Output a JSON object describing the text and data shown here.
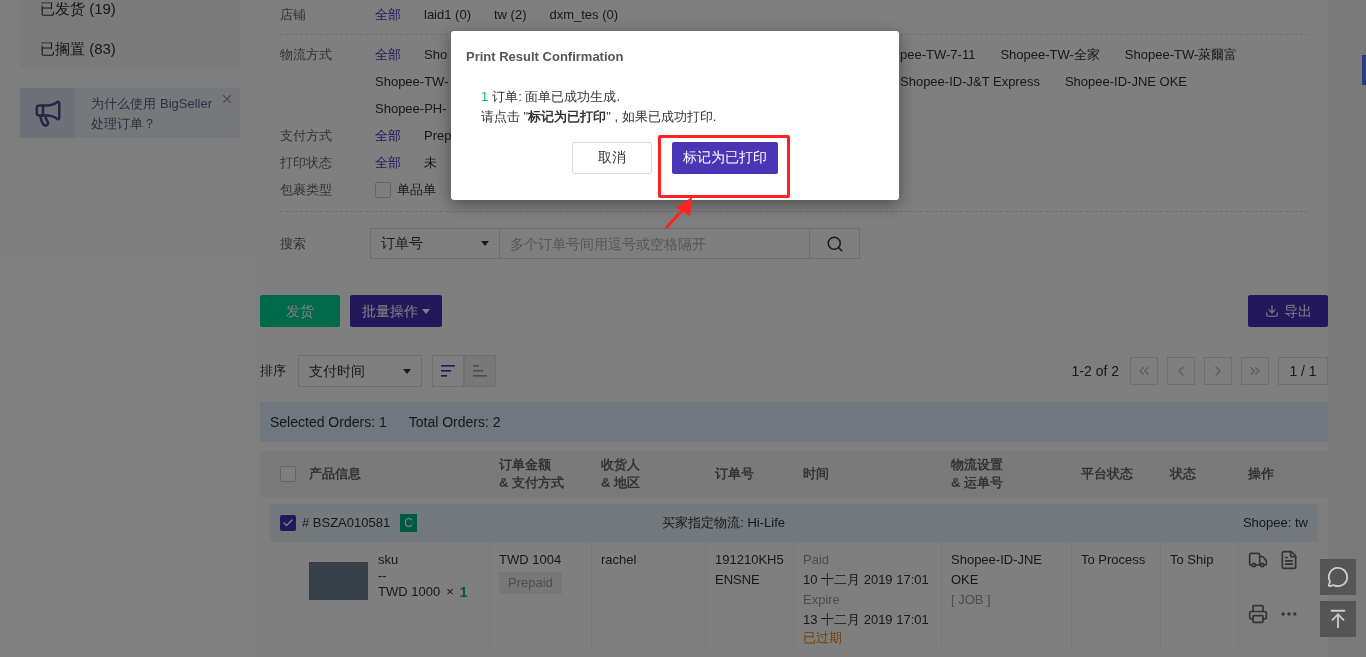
{
  "sidebar": {
    "status_items": [
      {
        "label": "已发货 (19)"
      },
      {
        "label": "已搁置 (83)"
      }
    ],
    "promo": {
      "text": "为什么使用 BigSeller处理订单？"
    }
  },
  "filters": [
    {
      "label": "店铺",
      "kind": "options",
      "lines": [
        {
          "left": [
            {
              "label": "全部",
              "selected": true
            },
            {
              "label": "laid1 (0)",
              "selected": false
            },
            {
              "label": "tw (2)",
              "selected": false
            },
            {
              "label": "dxm_tes (0)",
              "selected": false
            }
          ]
        }
      ]
    },
    {
      "label": "物流方式",
      "kind": "options",
      "lines": [
        {
          "left": [
            {
              "label": "全部",
              "selected": true
            },
            {
              "label": "Sho",
              "selected": false
            }
          ],
          "right": [
            {
              "label": "pee-TW-7-11",
              "selected": false
            },
            {
              "label": "Shopee-TW-全家",
              "selected": false
            },
            {
              "label": "Shopee-TW-萊爾富",
              "selected": false
            }
          ]
        },
        {
          "left": [
            {
              "label": "Shopee-TW-",
              "selected": false
            }
          ],
          "right": [
            {
              "label": "Shopee-ID-J&T Express",
              "selected": false
            },
            {
              "label": "Shopee-ID-JNE OKE",
              "selected": false
            }
          ]
        },
        {
          "left": [
            {
              "label": "Shopee-PH-",
              "selected": false
            }
          ]
        }
      ]
    },
    {
      "label": "支付方式",
      "kind": "options",
      "lines": [
        {
          "left": [
            {
              "label": "全部",
              "selected": true
            },
            {
              "label": "Prep",
              "selected": false
            }
          ]
        }
      ]
    },
    {
      "label": "打印状态",
      "kind": "options",
      "lines": [
        {
          "left": [
            {
              "label": "全部",
              "selected": true
            },
            {
              "label": "未",
              "selected": false
            }
          ]
        }
      ]
    },
    {
      "label": "包裹类型",
      "kind": "checkbox",
      "checked": false,
      "option": "单品单"
    }
  ],
  "search": {
    "label": "搜索",
    "field": "订单号",
    "placeholder": "多个订单号间用逗号或空格隔开"
  },
  "actions": {
    "ship": "发货",
    "batch": "批量操作",
    "export": "导出"
  },
  "sort": {
    "label": "排序",
    "value": "支付时间",
    "directions": [
      {
        "kind": "desc",
        "selected": true
      },
      {
        "kind": "asc",
        "selected": false
      }
    ]
  },
  "pagination": {
    "range": "1-2 of 2",
    "page": "1 / 1"
  },
  "summary": {
    "selected": "Selected Orders: 1",
    "total": "Total Orders: 2"
  },
  "table": {
    "header_checked": false,
    "columns": [
      "产品信息",
      "订单金额\n& 支付方式",
      "收货人\n& 地区",
      "订单号",
      "时间",
      "物流设置\n& 运单号",
      "平台状态",
      "状态",
      "操作"
    ]
  },
  "orders": [
    {
      "checked": true,
      "number": "# BSZA010581",
      "badge": "C",
      "carrier_note": "买家指定物流: Hi-Life",
      "store": "Shopee: tw",
      "items": [
        {
          "sku": "sku",
          "variant": "--",
          "price": "TWD 1000",
          "multiply": "×",
          "quantity": "1"
        }
      ],
      "amount": "TWD 1004",
      "payment": "Prepaid",
      "recipient": "rachel",
      "order_no": "191210KH5ENSNE",
      "times": [
        {
          "label": "Paid",
          "value": "10 十二月 2019 17:01"
        },
        {
          "label": "Expire",
          "value": "13 十二月 2019 17:01"
        }
      ],
      "time_status": "已过期",
      "logistics": "Shopee-ID-JNE OKE",
      "tracking": "[ JOB ]",
      "platform_status": "To Process",
      "status": "To Ship"
    }
  ],
  "dialog": {
    "title": "Print Result Confirmation",
    "count": "1",
    "message": "订单: 面单已成功生成.",
    "instruction": "请点击 \"**标记为已打印**\" , 如果已成功打印.",
    "buttons": [
      {
        "label": "取消",
        "kind": "secondary"
      },
      {
        "label": "标记为已打印",
        "kind": "primary"
      }
    ]
  }
}
